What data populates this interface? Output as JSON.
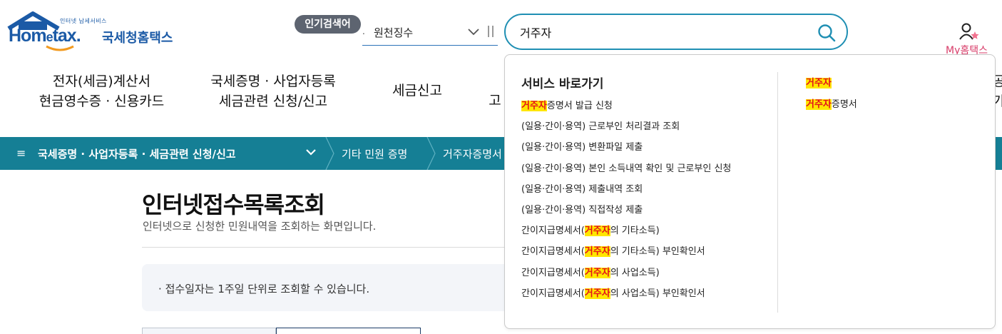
{
  "header": {
    "logo_small": "인터넷 납세서비스",
    "logo_home": "Hom",
    "logo_e": "e",
    "logo_tax": "tax.",
    "logo_kor": "국세청홈택스"
  },
  "popular": {
    "badge": "인기검색어",
    "dot": ".",
    "selected": "원천징수"
  },
  "search": {
    "value": "거주자",
    "icon": "search-icon"
  },
  "my": {
    "label": "My홈택스",
    "icon": "user-star-icon"
  },
  "gnb": {
    "item1_line1": "전자(세금)계산서",
    "item1_line2": "현금영수증 · 신용카드",
    "item2_line1": "국세증명 · 사업자등록",
    "item2_line2": "세금관련 신청/신고",
    "item3": "세금신고",
    "item4": "고",
    "item5_line1": "공",
    "item5_line2": "가"
  },
  "breadcrumb": {
    "menu_icon": "≡",
    "level1": "국세증명 · 사업자등록 · 세금관련 신청/신고",
    "level2": "기타 민원 증명",
    "level3": "거주자증명서"
  },
  "main": {
    "title": "인터넷접수목록조회",
    "description": "인터넷으로 신청한 민원내역을 조회하는 화면입니다.",
    "notice": "접수일자는 1주일 단위로 조회할 수 있습니다.",
    "notice_bullet": "·"
  },
  "autocomplete": {
    "section_title": "서비스 바로가기",
    "keyword": "거주자",
    "services": [
      {
        "pre": "",
        "hl": "거주자",
        "post": "증명서 발급 신청"
      },
      {
        "pre": "(일용·간이·용역) 근로부인 처리결과 조회",
        "hl": "",
        "post": ""
      },
      {
        "pre": "(일용·간이·용역) 변환파일 제출",
        "hl": "",
        "post": ""
      },
      {
        "pre": "(일용·간이·용역) 본인 소득내역 확인 및 근로부인 신청",
        "hl": "",
        "post": ""
      },
      {
        "pre": "(일용·간이·용역) 제출내역 조회",
        "hl": "",
        "post": ""
      },
      {
        "pre": "(일용·간이·용역) 직접작성 제출",
        "hl": "",
        "post": ""
      },
      {
        "pre": "간이지급명세서(",
        "hl": "거주자",
        "post": "의 기타소득)"
      },
      {
        "pre": "간이지급명세서(",
        "hl": "거주자",
        "post": "의 기타소득) 부인확인서"
      },
      {
        "pre": "간이지급명세서(",
        "hl": "거주자",
        "post": "의 사업소득)"
      },
      {
        "pre": "간이지급명세서(",
        "hl": "거주자",
        "post": "의 사업소득) 부인확인서"
      }
    ],
    "keywords": [
      {
        "hl": "거주자",
        "post": ""
      },
      {
        "hl": "거주자",
        "post": "증명서"
      }
    ]
  },
  "colors": {
    "brand_blue": "#1b5aa6",
    "breadcrumb_bg": "#157f95",
    "search_border": "#1f8fb3",
    "highlight_bg": "#ffe600",
    "highlight_text": "#e3111b",
    "my_label": "#d83c69"
  }
}
